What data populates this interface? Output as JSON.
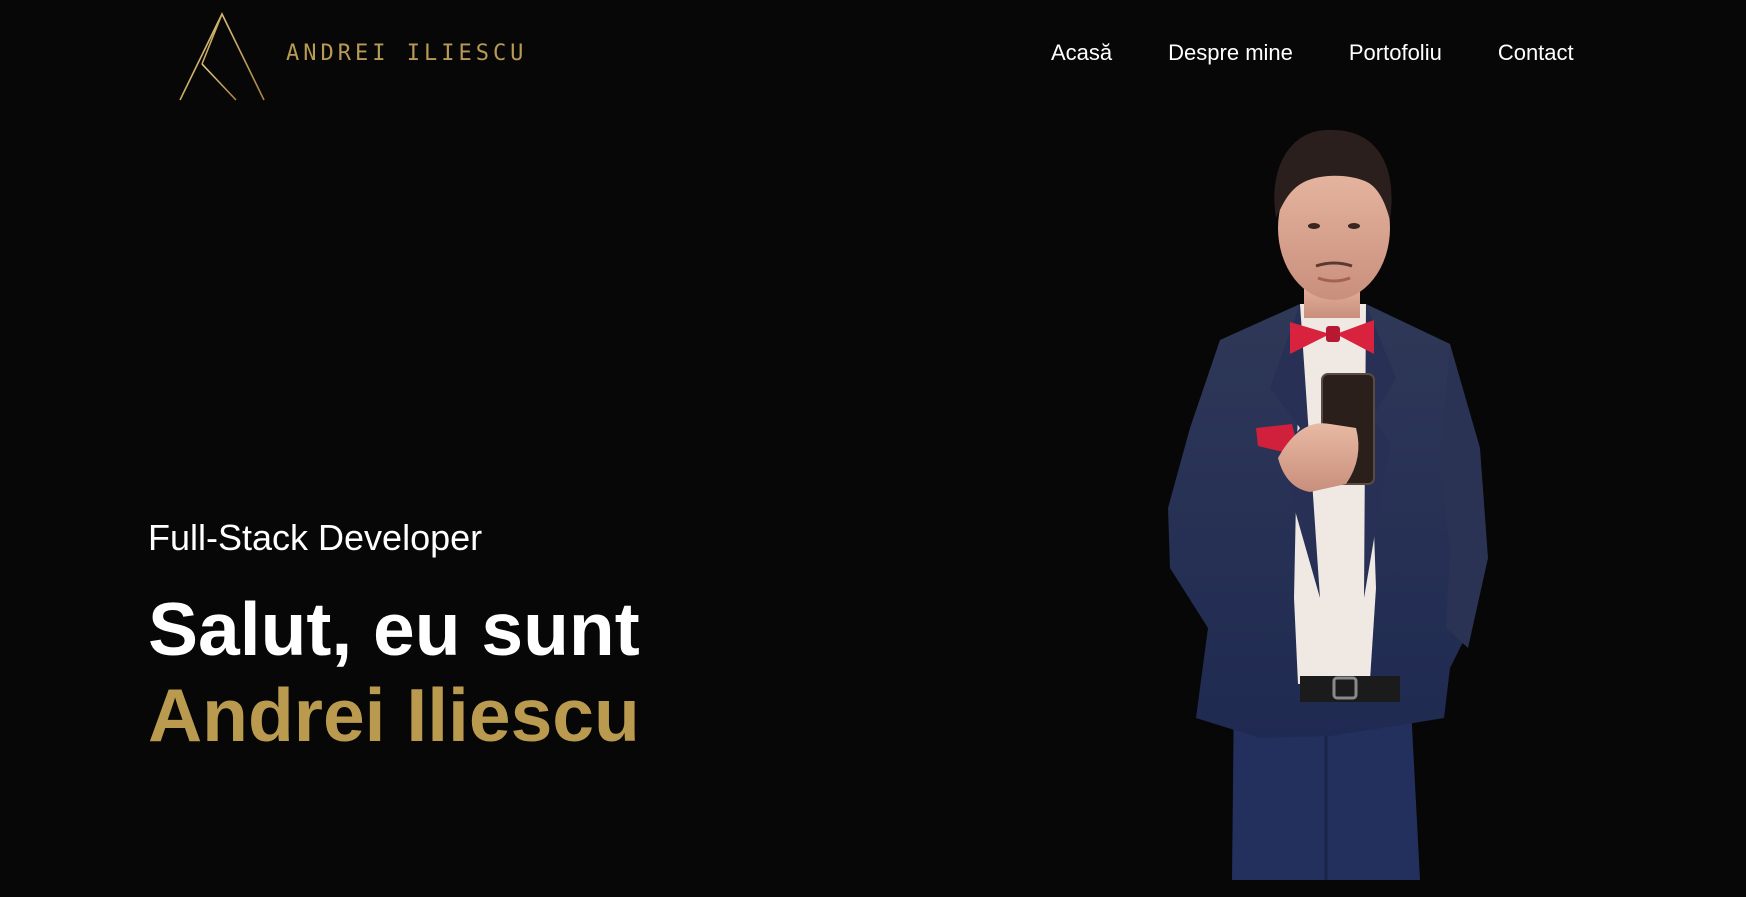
{
  "header": {
    "logo_text": "ANDREI ILIESCU",
    "logo_icon": "letter-a-logo",
    "nav": [
      {
        "label": "Acasă"
      },
      {
        "label": "Despre mine"
      },
      {
        "label": "Portofoliu"
      },
      {
        "label": "Contact"
      }
    ]
  },
  "hero": {
    "subtitle": "Full-Stack Developer",
    "greeting": "Salut, eu sunt",
    "name": "Andrei Iliescu",
    "portrait_icon": "person-portrait"
  },
  "colors": {
    "background": "#070707",
    "accent_gold": "#b99a4f",
    "text": "#ffffff"
  }
}
